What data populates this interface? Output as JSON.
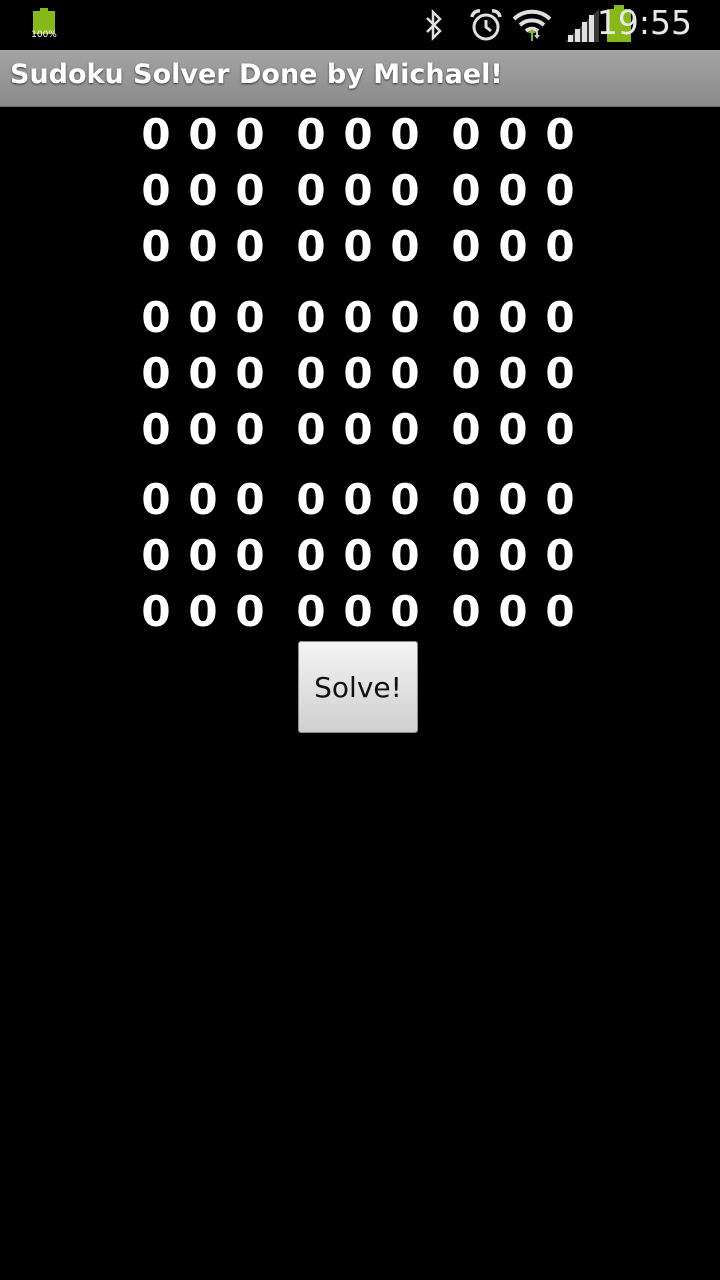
{
  "status_bar": {
    "battery_notification_label": "100%",
    "time": "19:55",
    "icons": [
      "battery-full-notification-icon",
      "bluetooth-icon",
      "alarm-icon",
      "wifi-icon",
      "signal-icon",
      "battery-icon"
    ],
    "accent_color": "#86b817"
  },
  "app": {
    "title": "Sudoku Solver Done by Michael!"
  },
  "grid": {
    "rows": [
      [
        "0",
        "0",
        "0",
        "0",
        "0",
        "0",
        "0",
        "0",
        "0"
      ],
      [
        "0",
        "0",
        "0",
        "0",
        "0",
        "0",
        "0",
        "0",
        "0"
      ],
      [
        "0",
        "0",
        "0",
        "0",
        "0",
        "0",
        "0",
        "0",
        "0"
      ],
      [
        "0",
        "0",
        "0",
        "0",
        "0",
        "0",
        "0",
        "0",
        "0"
      ],
      [
        "0",
        "0",
        "0",
        "0",
        "0",
        "0",
        "0",
        "0",
        "0"
      ],
      [
        "0",
        "0",
        "0",
        "0",
        "0",
        "0",
        "0",
        "0",
        "0"
      ],
      [
        "0",
        "0",
        "0",
        "0",
        "0",
        "0",
        "0",
        "0",
        "0"
      ],
      [
        "0",
        "0",
        "0",
        "0",
        "0",
        "0",
        "0",
        "0",
        "0"
      ],
      [
        "0",
        "0",
        "0",
        "0",
        "0",
        "0",
        "0",
        "0",
        "0"
      ]
    ]
  },
  "actions": {
    "solve_label": "Solve!"
  }
}
